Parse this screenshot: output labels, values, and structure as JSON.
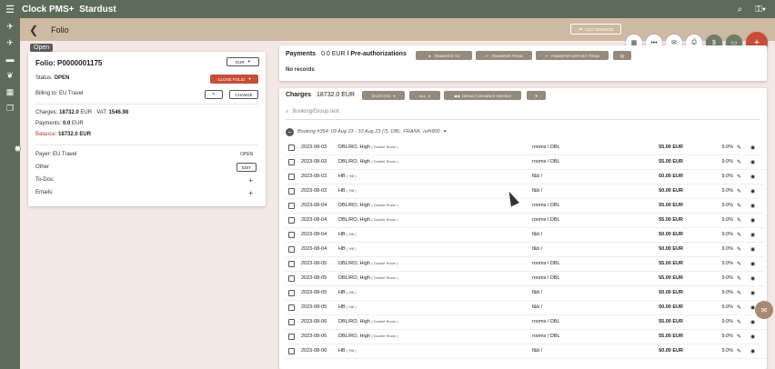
{
  "app": {
    "title": "Clock PMS+",
    "property": "Stardust"
  },
  "icons": {
    "menu": "hamburger-icon",
    "search": "search-icon",
    "key": "key-icon",
    "nav": [
      "plane-arrival-icon",
      "plane-departure-icon",
      "bed-icon",
      "leaf-icon",
      "calendar-icon",
      "copy-icon"
    ]
  },
  "header": {
    "title": "Folio",
    "old_version": "OLD VERSION",
    "tooltip": "Open"
  },
  "fab": {
    "qr": "▦",
    "more": "•••",
    "mail": "✉",
    "print": "⎙",
    "money": "$",
    "card": "▭",
    "plus": "+"
  },
  "folio": {
    "number": "Folio: P0000001175",
    "currency": "EUR",
    "status_label": "Status:",
    "status_value": "OPEN",
    "close_button": "CLOSE FOLIO",
    "billing_label": "Billing to:",
    "billing_value": "EU Travel",
    "change_button": "CHANGE",
    "charges_label": "Charges:",
    "charges_value": "18732.0",
    "charges_currency": "EUR",
    "vat_label": "VAT:",
    "vat_value": "1546.98",
    "payments_label": "Payments:",
    "payments_value": "0.0",
    "payments_currency": "EUR",
    "balance_label": "Balance:",
    "balance_value": "18732.0 EUR",
    "payer_label": "Payer:",
    "payer_value": "EU Travel",
    "payer_status": "OPEN",
    "other_label": "Other",
    "edit_button": "EDIT",
    "todos_label": "To-Dos:",
    "emails_label": "Emails:"
  },
  "payments": {
    "title": "Payments",
    "amount": "0.0 EUR",
    "preauth": "/ Pre-authorizations",
    "transfer_to": "TRANSFER TO",
    "transfer_from": "TRANSFER FROM",
    "transfer_deposit": "TRANSFER DEPOSIT FROM",
    "empty": "No records"
  },
  "charges": {
    "title": "Charges",
    "amount": "18732.0 EUR",
    "selected_button": "SELECTED",
    "all_button": "ALL",
    "deduct_button": "DEDUCT ADVANCE INVOICE",
    "search_placeholder": "Booking/Group text",
    "booking_label": "Booking #354: 03 Aug 23 - 10 Aug 23 (7), DBL, FRANK, ref#800",
    "rows": [
      {
        "date": "2023-08-03",
        "desc": "DBL/RO, High",
        "sub": "( Double Room )",
        "cat": "rooms / DBL",
        "amount": "55.00 EUR",
        "vat": "9.0%"
      },
      {
        "date": "2023-08-03",
        "desc": "DBL/RO, High",
        "sub": "( Double Room )",
        "cat": "rooms / DBL",
        "amount": "55.00 EUR",
        "vat": "9.0%"
      },
      {
        "date": "2023-08-03",
        "desc": "HB",
        "sub": "( HB )",
        "cat": "f&b /",
        "amount": "50.00 EUR",
        "vat": "9.0%"
      },
      {
        "date": "2023-08-03",
        "desc": "HB",
        "sub": "( HB )",
        "cat": "f&b /",
        "amount": "50.00 EUR",
        "vat": "9.0%"
      },
      {
        "date": "2023-08-04",
        "desc": "DBL/RO, High",
        "sub": "( Double Room )",
        "cat": "rooms / DBL",
        "amount": "55.00 EUR",
        "vat": "9.0%"
      },
      {
        "date": "2023-08-04",
        "desc": "DBL/RO, High",
        "sub": "( Double Room )",
        "cat": "rooms / DBL",
        "amount": "55.00 EUR",
        "vat": "9.0%"
      },
      {
        "date": "2023-08-04",
        "desc": "HB",
        "sub": "( HB )",
        "cat": "f&b /",
        "amount": "50.00 EUR",
        "vat": "9.0%"
      },
      {
        "date": "2023-08-04",
        "desc": "HB",
        "sub": "( HB )",
        "cat": "f&b /",
        "amount": "50.00 EUR",
        "vat": "9.0%"
      },
      {
        "date": "2023-08-05",
        "desc": "DBL/RO, High",
        "sub": "( Double Room )",
        "cat": "rooms / DBL",
        "amount": "55.00 EUR",
        "vat": "9.0%"
      },
      {
        "date": "2023-08-05",
        "desc": "DBL/RO, High",
        "sub": "( Double Room )",
        "cat": "rooms / DBL",
        "amount": "55.00 EUR",
        "vat": "9.0%"
      },
      {
        "date": "2023-08-05",
        "desc": "HB",
        "sub": "( HB )",
        "cat": "f&b /",
        "amount": "50.00 EUR",
        "vat": "9.0%"
      },
      {
        "date": "2023-08-05",
        "desc": "HB",
        "sub": "( HB )",
        "cat": "f&b /",
        "amount": "50.00 EUR",
        "vat": "9.0%"
      },
      {
        "date": "2023-08-06",
        "desc": "DBL/RO, High",
        "sub": "( Double Room )",
        "cat": "rooms / DBL",
        "amount": "55.00 EUR",
        "vat": "9.0%"
      },
      {
        "date": "2023-08-06",
        "desc": "DBL/RO, High",
        "sub": "( Double Room )",
        "cat": "rooms / DBL",
        "amount": "55.00 EUR",
        "vat": "9.0%"
      },
      {
        "date": "2023-08-06",
        "desc": "HB",
        "sub": "( HB )",
        "cat": "f&b /",
        "amount": "50.00 EUR",
        "vat": "9.0%"
      }
    ]
  }
}
